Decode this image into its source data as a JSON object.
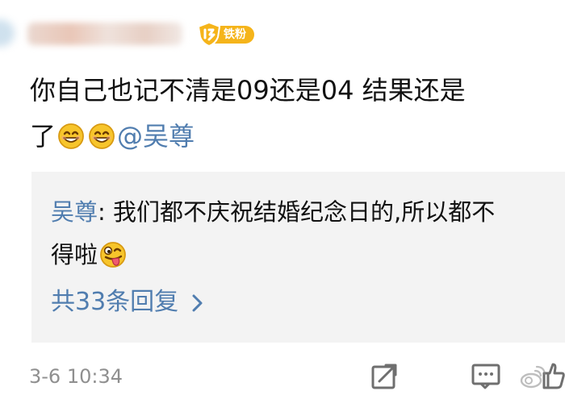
{
  "header": {
    "fan_badge_label": "铁粉"
  },
  "post": {
    "line1": "你自己也记不清是09还是04 结果还是",
    "line2_prefix": "了",
    "emojis": [
      "grinning-face",
      "grinning-face"
    ],
    "mention": "@吴尊"
  },
  "comment": {
    "author": "吴尊",
    "separator": ": ",
    "line1_text": "我们都不庆祝结婚纪念日的,所以都不",
    "line2_text": "得啦",
    "line2_emoji": "silly-tongue-face"
  },
  "replies": {
    "link_label": "共33条回复"
  },
  "footer": {
    "timestamp": "3-6 10:34",
    "actions": [
      "share-icon",
      "comment-icon",
      "like-icon"
    ],
    "watermark_icon": "weibo-logo-icon"
  },
  "colors": {
    "link_blue": "#507daf",
    "badge_orange": "#f5b41a",
    "card_gray": "#f3f3f3",
    "timestamp_gray": "#8f8f8f",
    "emoji_yellow": "#f7c52b"
  }
}
